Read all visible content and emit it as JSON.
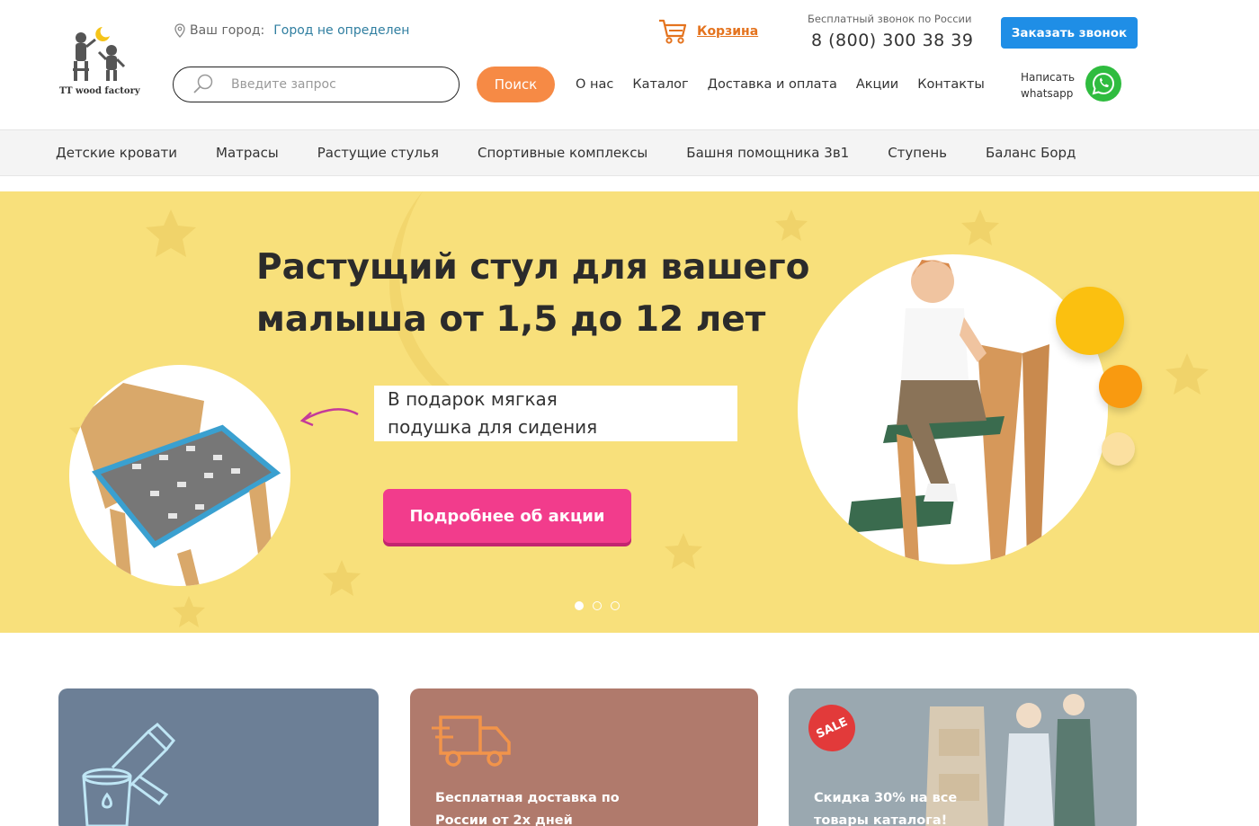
{
  "header": {
    "logo_text": "TT wood factory",
    "city_label": "Ваш город:",
    "city_value": "Город не определен",
    "search_placeholder": "Введите запрос",
    "search_button": "Поиск",
    "nav": [
      "О нас",
      "Каталог",
      "Доставка и оплата",
      "Акции",
      "Контакты"
    ],
    "cart_label": "Корзина",
    "phone_note": "Бесплатный звонок по России",
    "phone": "8 (800) 300 38 39",
    "callback_button": "Заказать звонок",
    "whatsapp_line1": "Написать",
    "whatsapp_line2": "whatsapp"
  },
  "categories": [
    "Детские кровати",
    "Матрасы",
    "Растущие стулья",
    "Спортивные комплексы",
    "Башня помощника 3в1",
    "Ступень",
    "Баланс Борд"
  ],
  "hero": {
    "title_line1": "Растущий стул для вашего",
    "title_line2": "малыша от 1,5 до 12 лет",
    "gift_line1": "В подарок мягкая",
    "gift_line2": "подушка для сидения",
    "promo_button": "Подробнее об акции",
    "slides_total": 3,
    "active_slide": 1,
    "colors": {
      "background": "#f8e07b",
      "button": "#f23c8c"
    }
  },
  "cards": [
    {
      "icon": "paint-bucket-icon",
      "line1": "",
      "line2": ""
    },
    {
      "icon": "delivery-truck-icon",
      "line1": "Бесплатная доставка по",
      "line2": "России от 2х дней"
    },
    {
      "icon": "sale-badge",
      "badge": "SALE",
      "line1": "Скидка 30% на все",
      "line2": "товары каталога!"
    }
  ],
  "colors": {
    "accent_orange": "#f68a45",
    "accent_blue": "#1f8ee6",
    "whatsapp_green": "#2fbc3f"
  }
}
